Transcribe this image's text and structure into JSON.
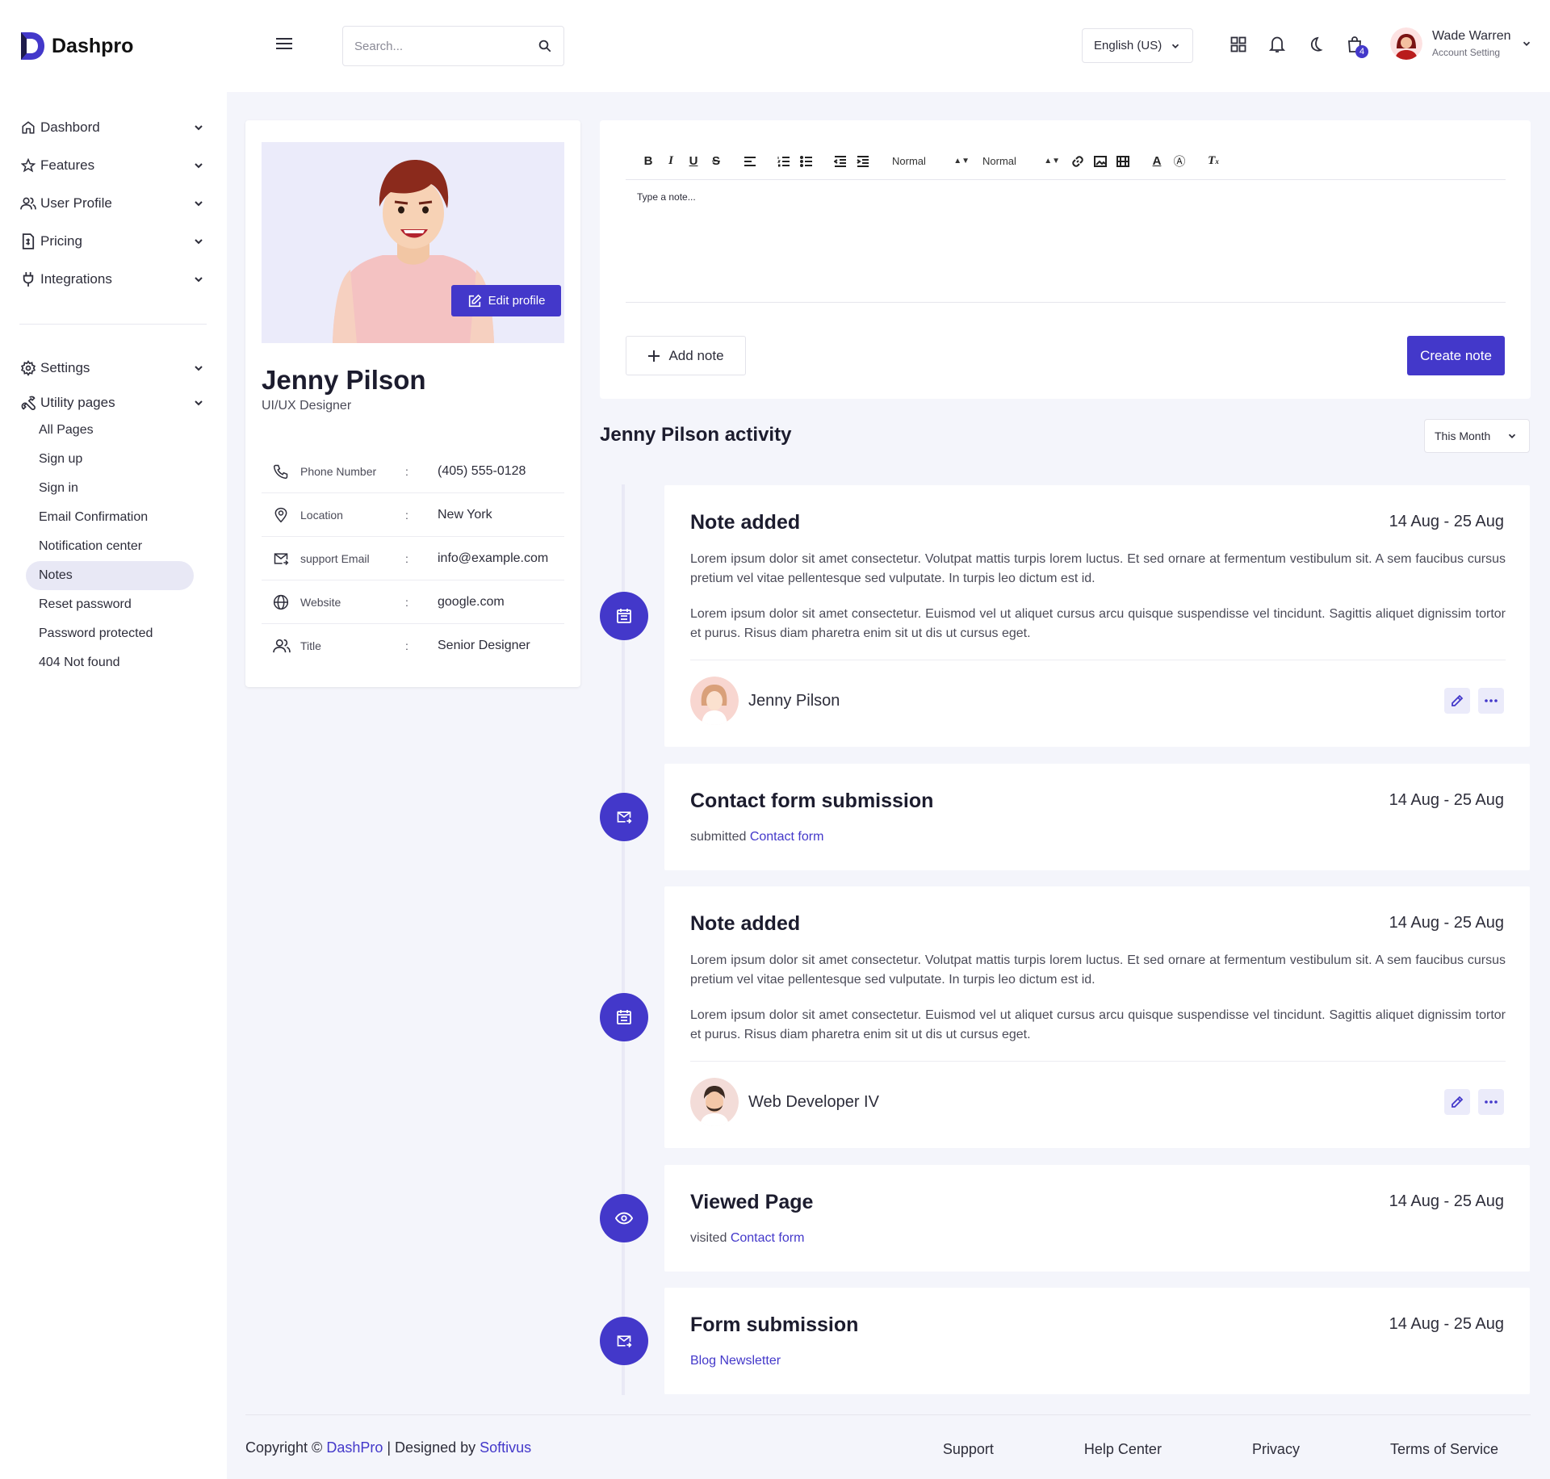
{
  "brand": {
    "name": "Dashpro",
    "accent": "#4338ca"
  },
  "sidebar": {
    "items": [
      {
        "label": "Dashbord",
        "icon": "home-icon"
      },
      {
        "label": "Features",
        "icon": "star-icon"
      },
      {
        "label": "User Profile",
        "icon": "users-icon"
      },
      {
        "label": "Pricing",
        "icon": "invoice-icon"
      },
      {
        "label": "Integrations",
        "icon": "plug-icon"
      }
    ],
    "settings": {
      "label": "Settings",
      "icon": "gear-icon"
    },
    "utility": {
      "label": "Utility pages",
      "icon": "tools-icon",
      "children": [
        "All Pages",
        "Sign up",
        "Sign in",
        "Email Confirmation",
        "Notification center",
        "Notes",
        "Reset password",
        "Password protected",
        "404 Not found"
      ],
      "active": "Notes"
    }
  },
  "topbar": {
    "search_placeholder": "Search...",
    "language": "English (US)",
    "cart_count": "4",
    "user": {
      "name": "Wade Warren",
      "subtitle": "Account Setting"
    }
  },
  "profile": {
    "name": "Jenny Pilson",
    "role": "UI/UX Designer",
    "edit_label": "Edit profile",
    "details": [
      {
        "icon": "phone-icon",
        "label": "Phone Number",
        "value": "(405) 555-0128"
      },
      {
        "icon": "location-icon",
        "label": "Location",
        "value": "New York"
      },
      {
        "icon": "email-icon",
        "label": "support Email",
        "value": "info@example.com"
      },
      {
        "icon": "globe-icon",
        "label": "Website",
        "value": "google.com"
      },
      {
        "icon": "user-group-icon",
        "label": "Title",
        "value": "Senior Designer"
      }
    ]
  },
  "editor": {
    "font_size": "Normal",
    "heading": "Normal",
    "placeholder": "Type a note...",
    "add_note": "Add note",
    "create_note": "Create note"
  },
  "activity": {
    "title": "Jenny Pilson activity",
    "filter": "This Month",
    "items": [
      {
        "title": "Note added",
        "date": "14 Aug - 25 Aug",
        "p1": "Lorem ipsum dolor sit amet consectetur. Volutpat mattis turpis lorem luctus. Et sed ornare at fermentum vestibulum sit. A sem faucibus cursus pretium vel vitae pellentesque sed vulputate. In turpis leo dictum est id.",
        "p2": "Lorem ipsum dolor sit amet consectetur. Euismod vel ut aliquet cursus arcu quisque suspendisse vel tincidunt. Sagittis aliquet dignissim tortor et purus. Risus diam pharetra enim sit ut dis ut cursus eget.",
        "author": "Jenny Pilson"
      },
      {
        "title": "Contact form submission",
        "date": "14 Aug - 25 Aug",
        "prefix": "submitted",
        "link": "Contact form"
      },
      {
        "title": "Note added",
        "date": "14 Aug - 25 Aug",
        "p1": "Lorem ipsum dolor sit amet consectetur. Volutpat mattis turpis lorem luctus. Et sed ornare at fermentum vestibulum sit. A sem faucibus cursus pretium vel vitae pellentesque sed vulputate. In turpis leo dictum est id.",
        "p2": "Lorem ipsum dolor sit amet consectetur. Euismod vel ut aliquet cursus arcu quisque suspendisse vel tincidunt. Sagittis aliquet dignissim tortor et purus. Risus diam pharetra enim sit ut dis ut cursus eget.",
        "author": "Web Developer IV"
      },
      {
        "title": "Viewed Page",
        "date": "14 Aug - 25 Aug",
        "prefix": "visited",
        "link": "Contact form"
      },
      {
        "title": "Form submission",
        "date": "14 Aug - 25 Aug",
        "prefix": "",
        "link": "Blog Newsletter"
      }
    ]
  },
  "footer": {
    "copyright_prefix": "Copyright ©",
    "brand_link": "DashPro",
    "designed_by": "| Designed by",
    "designer_link": "Softivus",
    "links": [
      "Support",
      "Help Center",
      "Privacy",
      "Terms of Service"
    ]
  }
}
